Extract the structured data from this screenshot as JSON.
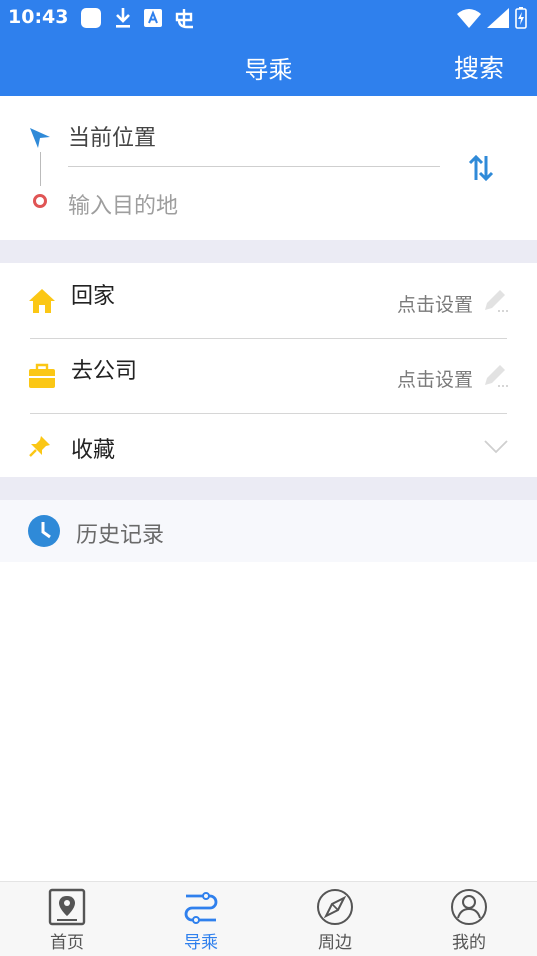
{
  "status_bar": {
    "time": "10:43",
    "icons": [
      "square-icon",
      "download-icon",
      "a-box-icon",
      "bug-icon",
      "wifi-icon",
      "signal-icon",
      "battery-charging-icon"
    ]
  },
  "app_bar": {
    "title": "导乘",
    "search_label": "搜索"
  },
  "route": {
    "from_label": "当前位置",
    "to_placeholder": "输入目的地",
    "colors": {
      "from_icon": "#2f8ad8",
      "to_icon": "#e05555",
      "swap": "#2f8ad8"
    }
  },
  "quick": {
    "home": {
      "label": "回家",
      "action": "点击设置"
    },
    "work": {
      "label": "去公司",
      "action": "点击设置"
    },
    "favorites": {
      "label": "收藏"
    },
    "colors": {
      "icon": "#fbc715"
    }
  },
  "history": {
    "label": "历史记录",
    "color": "#2f8ad8"
  },
  "tabs": [
    {
      "label": "首页",
      "icon": "map-pin-icon",
      "active": false
    },
    {
      "label": "导乘",
      "icon": "route-icon",
      "active": true
    },
    {
      "label": "周边",
      "icon": "compass-icon",
      "active": false
    },
    {
      "label": "我的",
      "icon": "user-icon",
      "active": false
    }
  ],
  "theme": {
    "primary": "#2f80ed",
    "divider": "#ebebf4"
  }
}
